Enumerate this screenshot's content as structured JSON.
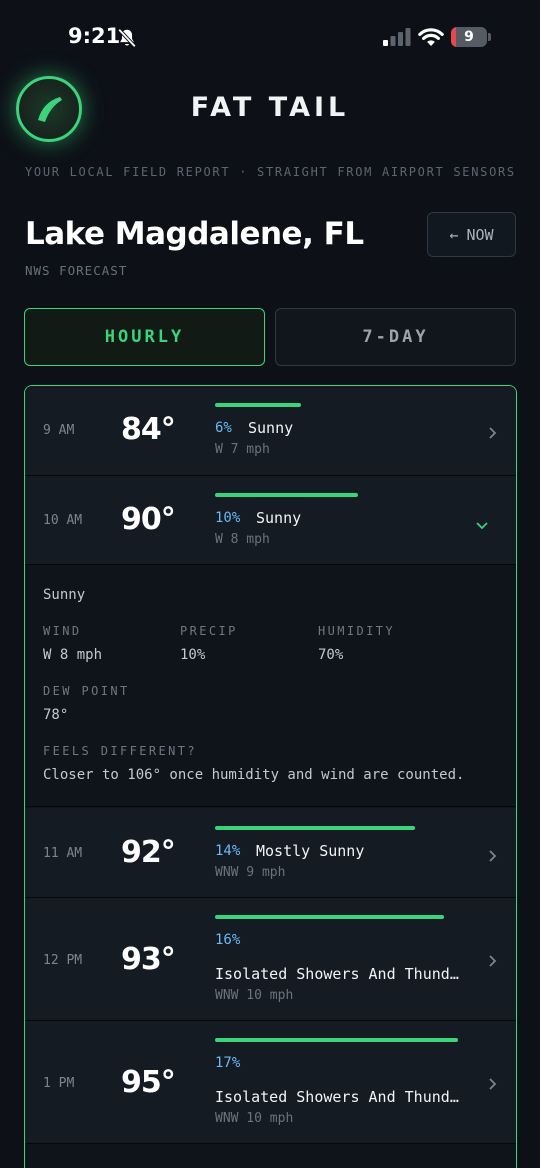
{
  "status_bar": {
    "time": "9:21",
    "battery": "9",
    "battery_level": 0.09
  },
  "header": {
    "app_name": "FAT TAIL",
    "tagline": "YOUR LOCAL FIELD REPORT · STRAIGHT FROM AIRPORT SENSORS"
  },
  "location": {
    "name": "Lake Magdalene, FL",
    "subtitle": "NWS FORECAST",
    "now_label": "NOW",
    "now_arrow": "←"
  },
  "tabs": [
    {
      "label": "HOURLY",
      "active": true
    },
    {
      "label": "7-DAY",
      "active": false
    }
  ],
  "colors": {
    "accent": "#3bd47a",
    "precip": "#6cb8f5",
    "background": "#0d1117"
  },
  "hours": [
    {
      "time": "9 AM",
      "temp": "84°",
      "precip": "6%",
      "precip_frac": 0.06,
      "condition": "Sunny",
      "wind": "W 7 mph",
      "expanded": false
    },
    {
      "time": "10 AM",
      "temp": "90°",
      "precip": "10%",
      "precip_frac": 0.1,
      "condition": "Sunny",
      "wind": "W 8 mph",
      "expanded": true
    },
    {
      "time": "11 AM",
      "temp": "92°",
      "precip": "14%",
      "precip_frac": 0.14,
      "condition": "Mostly Sunny",
      "wind": "WNW 9 mph",
      "expanded": false
    },
    {
      "time": "12 PM",
      "temp": "93°",
      "precip": "16%",
      "precip_frac": 0.16,
      "condition": "Isolated Showers And Thunderstorms",
      "wind": "WNW 10 mph",
      "expanded": false
    },
    {
      "time": "1 PM",
      "temp": "95°",
      "precip": "17%",
      "precip_frac": 0.17,
      "condition": "Isolated Showers And Thunderstorms",
      "wind": "WNW 10 mph",
      "expanded": false
    }
  ],
  "detail": {
    "summary": "Sunny",
    "wind_label": "WIND",
    "wind": "W 8 mph",
    "precip_label": "PRECIP",
    "precip": "10%",
    "humidity_label": "HUMIDITY",
    "humidity": "70%",
    "dew_label": "DEW POINT",
    "dew": "78°",
    "feels_label": "FEELS DIFFERENT?",
    "feels": "Closer to 106° once humidity and wind are counted."
  }
}
